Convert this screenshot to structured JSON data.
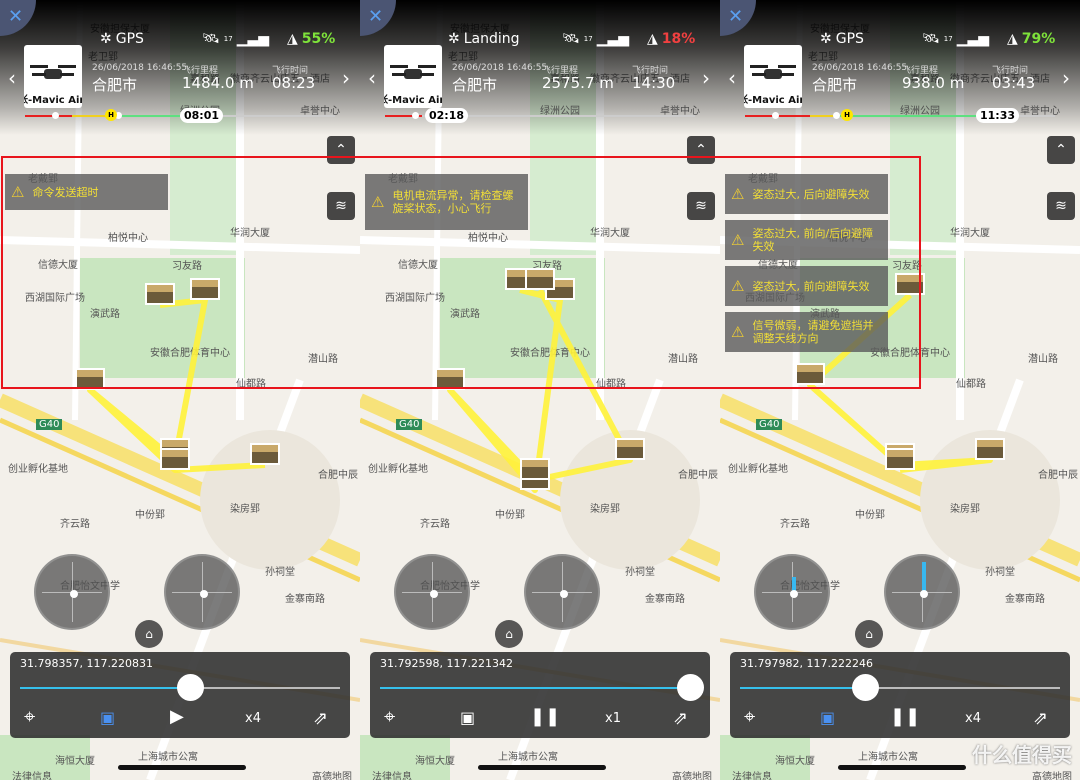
{
  "common": {
    "close_icon": "close-icon",
    "date": "26/06/2018 16:46:55",
    "city": "合肥市",
    "distance_label": "飞行里程",
    "time_label": "飞行时间",
    "drone_name": "张-Mavic Air",
    "satellite_count": "17",
    "home_marker": "H"
  },
  "map_labels": [
    "安徽担保大厦",
    "老卫郢",
    "嘉和路",
    "绿洲公园",
    "卓誉中心",
    "老戴郢",
    "柏悦中心",
    "华润大厦",
    "信德大厦",
    "习友路",
    "西湖国际广场",
    "演武路",
    "安徽合肥体育中心",
    "仙都路",
    "潜山路",
    "G40",
    "创业孵化基地",
    "合肥中辰",
    "染房郢",
    "中份郢",
    "齐云路",
    "孙祠堂",
    "合肥怡文中学",
    "金寨南路",
    "上海城市公寓",
    "海恒大厦",
    "法律信息",
    "高德地图",
    "徽商齐云山庄",
    "五一酒店"
  ],
  "panels": [
    {
      "mode": "GPS",
      "battery": "55%",
      "battery_color": "#7ee23a",
      "distance": "1484.0 m",
      "flight_time": "08:23",
      "timeline_time": "08:01",
      "warnings": [
        "命令发送超时"
      ],
      "coords": "31.798357, 117.220831",
      "progress": 0.53,
      "play_icon": "play-icon",
      "speed": "x4",
      "remote_active": true,
      "stick_left": 0,
      "stick_right": 0
    },
    {
      "mode": "Landing",
      "battery": "18%",
      "battery_color": "#f04040",
      "distance": "2575.7 m",
      "flight_time": "14:30",
      "timeline_time": "02:18",
      "warnings": [
        "电机电流异常，请检查螺旋桨状态，小心飞行"
      ],
      "coords": "31.792598, 117.221342",
      "progress": 0.97,
      "play_icon": "pause-icon",
      "speed": "x1",
      "remote_active": false,
      "stick_left": 0,
      "stick_right": 0
    },
    {
      "mode": "GPS",
      "battery": "79%",
      "battery_color": "#7ee23a",
      "distance": "938.0 m",
      "flight_time": "03:43",
      "timeline_time": "11:33",
      "warnings": [
        "姿态过大, 后向避障失效",
        "姿态过大, 前向/后向避障失效",
        "姿态过大, 前向避障失效",
        "信号微弱，请避免遮挡并调整天线方向"
      ],
      "coords": "31.797982, 117.222246",
      "progress": 0.39,
      "play_icon": "pause-icon",
      "speed": "x4",
      "remote_active": true,
      "stick_left": 0.5,
      "stick_right": 1
    }
  ],
  "watermark": "什么值得买",
  "colors": {
    "accent": "#36c0ec",
    "warning": "#f3df36",
    "highlight_box": "#e8141c",
    "flight_path": "#fff23a"
  }
}
